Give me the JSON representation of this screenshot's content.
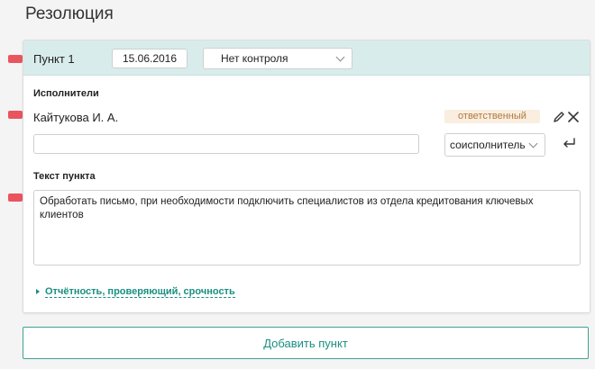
{
  "page": {
    "title": "Резолюция"
  },
  "item": {
    "label": "Пункт 1",
    "date": "15.06.2016",
    "control": "Нет контроля"
  },
  "executors": {
    "section_label": "Исполнители",
    "primary_name": "Кайтукова И. А.",
    "primary_role": "ответственный",
    "coexecutor_input_value": "",
    "role_select": "соисполнитель"
  },
  "item_text": {
    "section_label": "Текст пункта",
    "value": "Обработать письмо, при необходимости подключить специалистов из отдела кредитования ключевых клиентов"
  },
  "more_link": "Отчётность, проверяющий, срочность",
  "add_button": "Добавить пункт",
  "colors": {
    "accent": "#1a8f80",
    "marker": "#e9555f",
    "header_bg": "#d9ecec",
    "badge_bg": "#faeee0",
    "badge_text": "#b0793e"
  }
}
